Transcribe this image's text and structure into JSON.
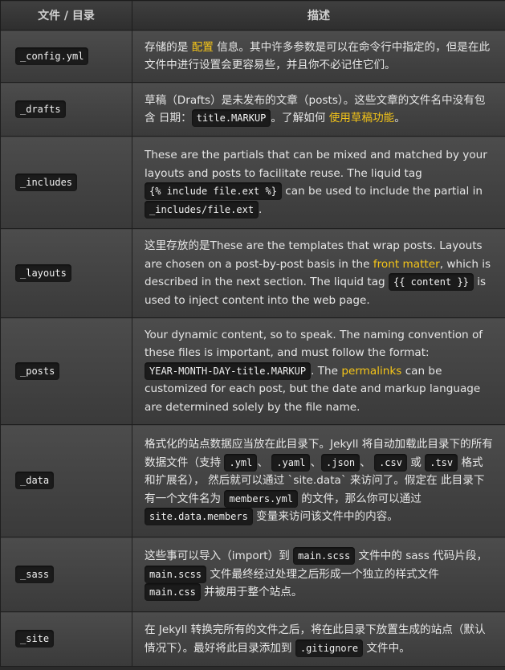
{
  "header": {
    "col_file": "文件 / 目录",
    "col_desc": "描述"
  },
  "rows": [
    {
      "name": "_config.yml",
      "d": {
        "t1": "存储的是 ",
        "l1": "配置",
        "t2": " 信息。其中许多参数是可以在命令行中指定的，但是在此文件中进行设置会更容易些，并且你不必记住它们。"
      }
    },
    {
      "name": "_drafts",
      "d": {
        "t1": "草稿（Drafts）是未发布的文章（posts）。这些文章的文件名中没有包含 日期：",
        "c1": "title.MARKUP",
        "t2": "。了解如何 ",
        "l1": "使用草稿功能",
        "t3": "。"
      }
    },
    {
      "name": "_includes",
      "d": {
        "t1": "These are the partials that can be mixed and matched by your layouts and posts to facilitate reuse. The liquid tag ",
        "c1": "{% include file.ext %}",
        "t2": " can be used to include the partial in ",
        "c2": "_includes/file.ext",
        "t3": "."
      }
    },
    {
      "name": "_layouts",
      "d": {
        "t1": "这里存放的是These are the templates that wrap posts. Layouts are chosen on a post-by-post basis in the ",
        "l1": "front matter",
        "t2": ", which is described in the next section. The liquid tag ",
        "c1": "{{ content }}",
        "t3": " is used to inject content into the web page."
      }
    },
    {
      "name": "_posts",
      "d": {
        "t1": "Your dynamic content, so to speak. The naming convention of these files is important, and must follow the format: ",
        "c1": "YEAR-MONTH-DAY-title.MARKUP",
        "t2": ". The ",
        "l1": "permalinks",
        "t3": " can be customized for each post, but the date and markup language are determined solely by the file name."
      }
    },
    {
      "name": "_data",
      "d": {
        "t1": "格式化的站点数据应当放在此目录下。Jekyll 将自动加载此目录下的所有数据文件（支持 ",
        "c1": ".yml",
        "t2": "、 ",
        "c2": ".yaml",
        "t3": "、",
        "c3": ".json",
        "t4": "、 ",
        "c4": ".csv",
        "t5": " 或 ",
        "c5": ".tsv",
        "t6": " 格式和扩展名）， 然后就可以通过 `site.data` 来访问了。假定在 此目录下有一个文件名为 ",
        "c6": "members.yml",
        "t7": " 的文件，那么你可以通过 ",
        "c7": "site.data.members",
        "t8": " 变量来访问该文件中的内容。"
      }
    },
    {
      "name": "_sass",
      "d": {
        "t1": "这些事可以导入（import）到 ",
        "c1": "main.scss",
        "t2": " 文件中的 sass 代码片段， ",
        "c2": "main.scss",
        "t3": " 文件最终经过处理之后形成一个独立的样式文件 ",
        "c3": "main.css",
        "t4": " 并被用于整个站点。"
      }
    },
    {
      "name": "_site",
      "d": {
        "t1": "在 Jekyll 转换完所有的文件之后，将在此目录下放置生成的站点（默认情况下）。最好将此目录添加到 ",
        "c1": ".gitignore",
        "t2": " 文件中。"
      }
    }
  ]
}
